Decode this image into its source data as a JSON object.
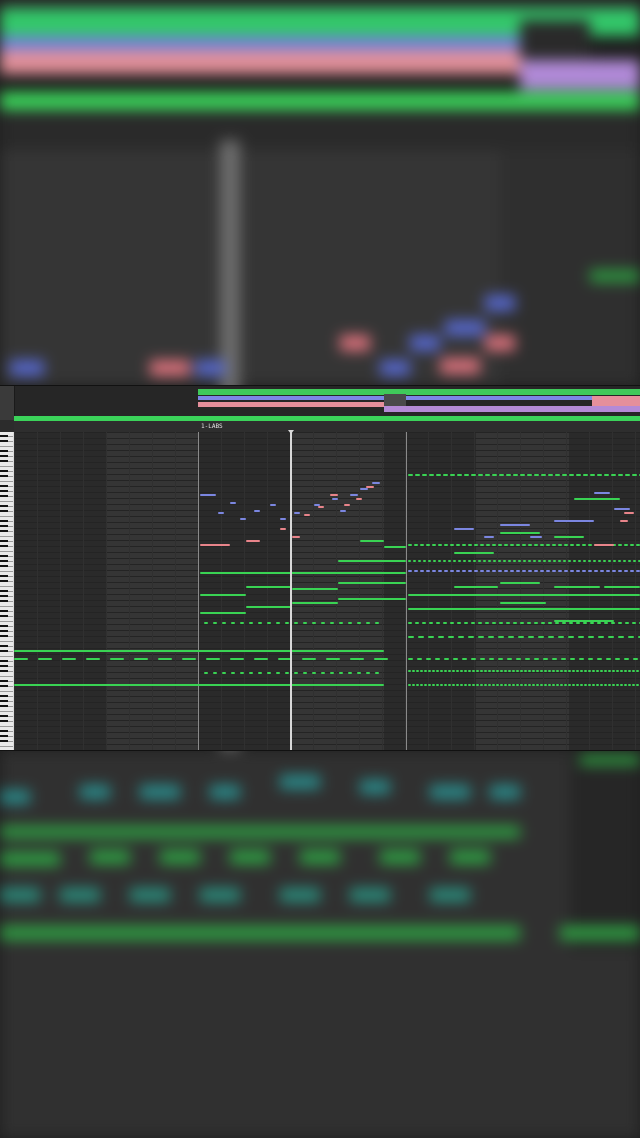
{
  "clip": {
    "label": "1-LABS"
  },
  "colors": {
    "note_green": "#39d353",
    "note_blue": "#7b86e0",
    "note_pink": "#e8848a",
    "playhead": "#d9d9d9",
    "roll_bg_dark": "#2a2a2a",
    "roll_bg_light": "#3a3a3a",
    "clip_lane_green": "#3fc95a",
    "clip_lane_blue": "#7c86e6",
    "clip_lane_purple": "#b48ad6",
    "clip_lane_pink": "#e58f9b"
  },
  "icons": [
    "playhead-marker-icon"
  ]
}
